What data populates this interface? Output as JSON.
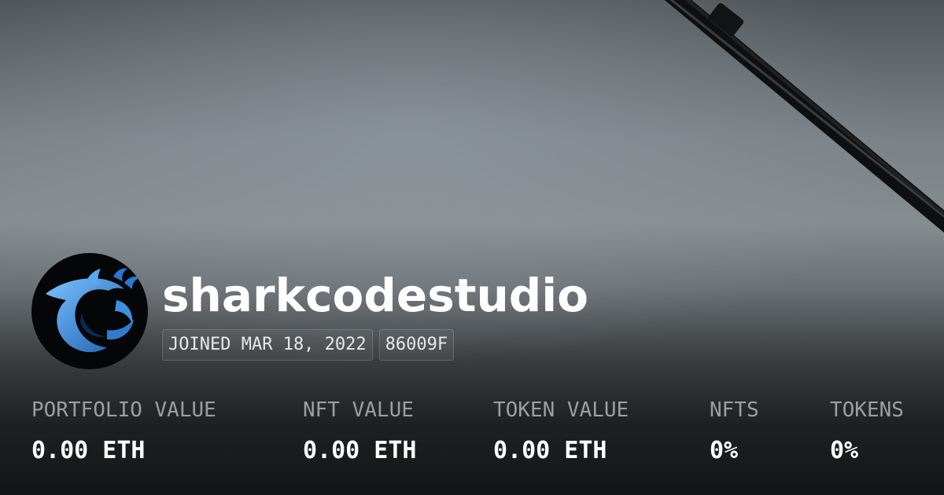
{
  "profile": {
    "username": "sharkcodestudio",
    "joined": "JOINED MAR 18, 2022",
    "address_short": "86009F",
    "avatar_icon": "shark-logo-icon"
  },
  "stats": [
    {
      "label": "PORTFOLIO VALUE",
      "value": "0.00 ETH"
    },
    {
      "label": "NFT VALUE",
      "value": "0.00 ETH"
    },
    {
      "label": "TOKEN VALUE",
      "value": "0.00 ETH"
    },
    {
      "label": "NFTS",
      "value": "0%"
    },
    {
      "label": "TOKENS",
      "value": "0%"
    }
  ],
  "colors": {
    "text_primary": "#ffffff",
    "text_muted": "#9a9fa4",
    "avatar_bg": "#050607",
    "shark_blue": "#3d8fe0"
  }
}
